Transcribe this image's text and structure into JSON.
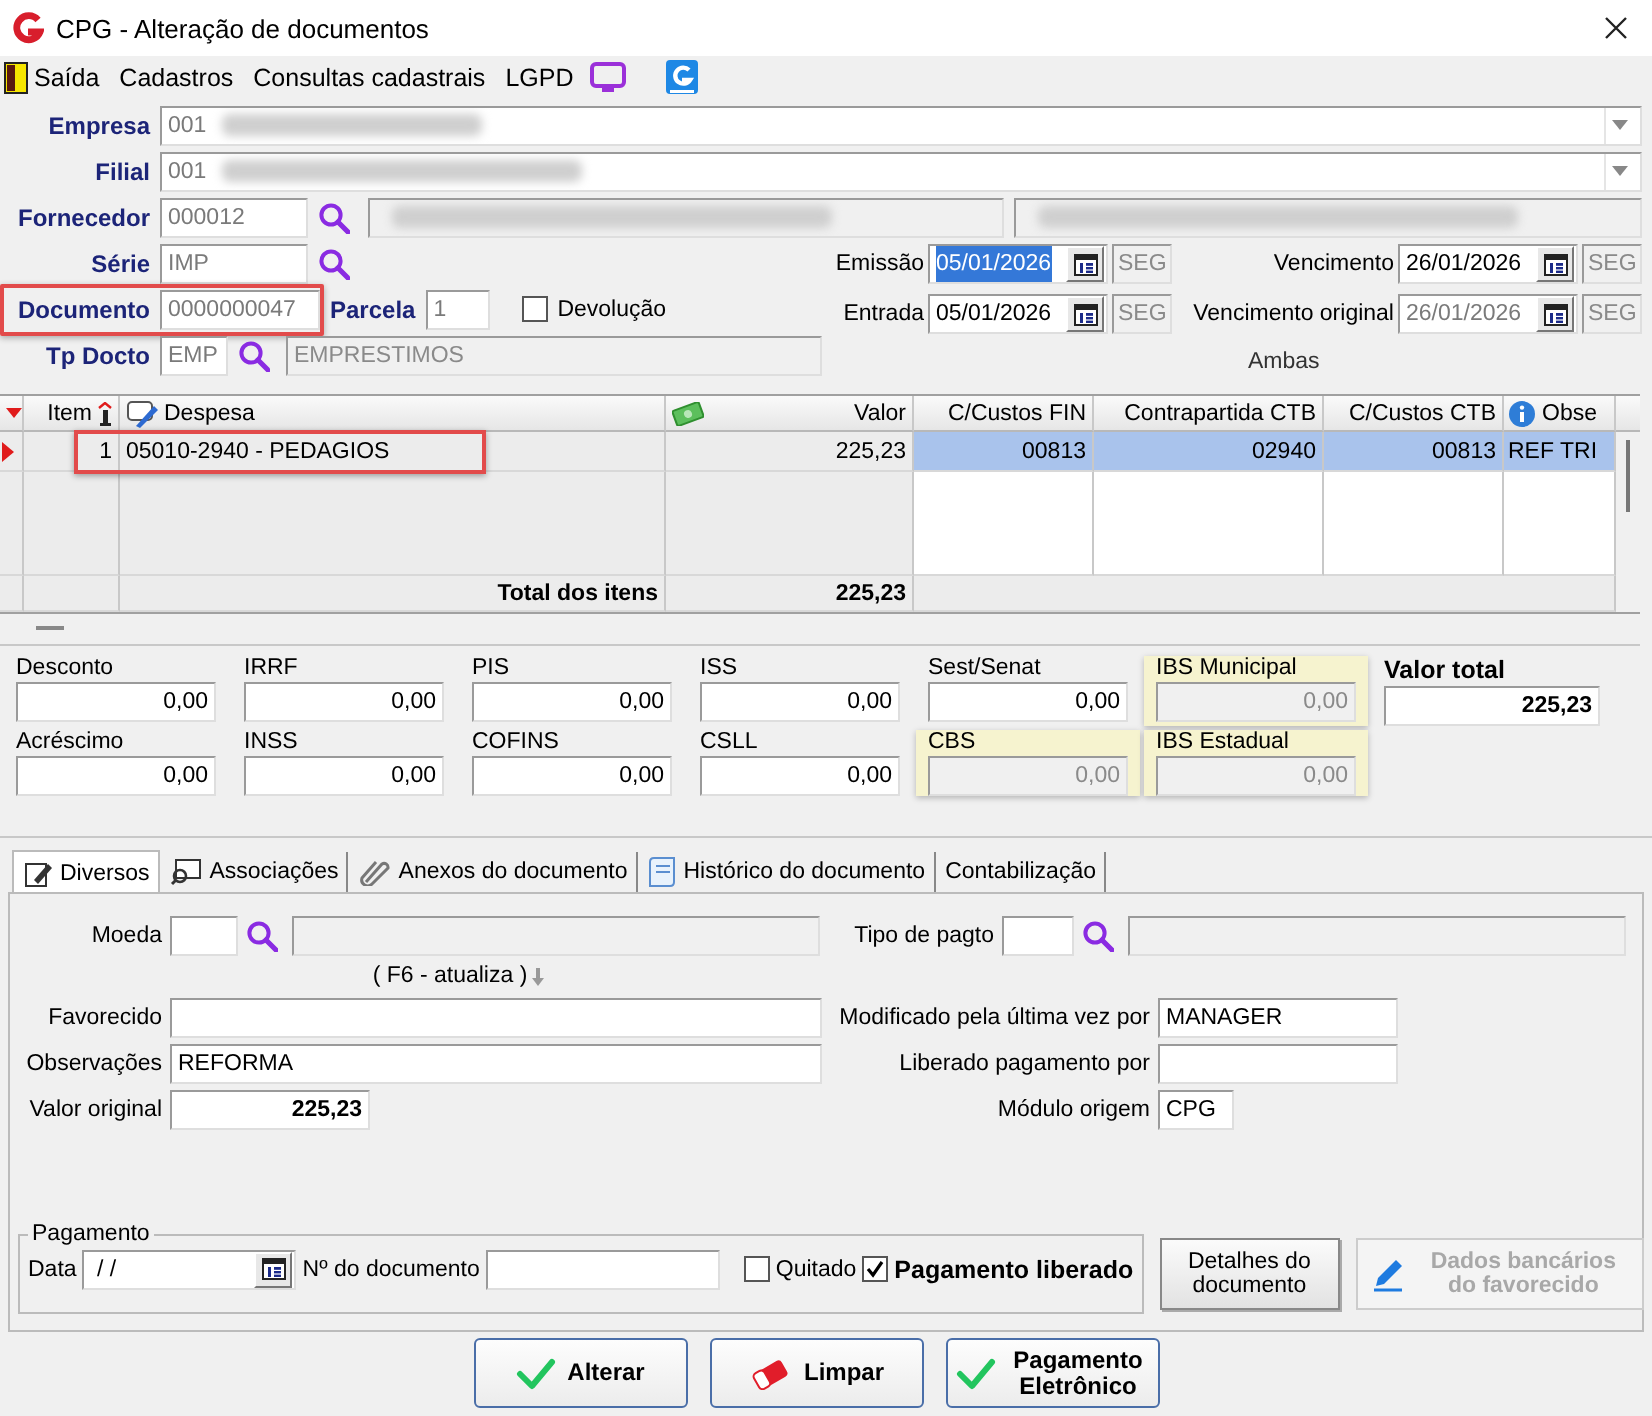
{
  "window": {
    "title": "CPG - Alteração de documentos"
  },
  "menu": [
    {
      "label": "Saída",
      "kind": "exit"
    },
    {
      "label": "Cadastros",
      "kind": "plain"
    },
    {
      "label": "Consultas cadastrais",
      "kind": "plain"
    },
    {
      "label": "LGPD",
      "kind": "plain"
    }
  ],
  "header": {
    "empresa": {
      "label": "Empresa",
      "value": "001"
    },
    "filial": {
      "label": "Filial",
      "value": "001"
    },
    "fornecedor": {
      "label": "Fornecedor",
      "value": "000012"
    },
    "serie": {
      "label": "Série",
      "value": "IMP"
    },
    "documento": {
      "label": "Documento",
      "value": "0000000047",
      "highlighted": true
    },
    "parcela": {
      "label": "Parcela",
      "value": "1"
    },
    "devolucao": {
      "label": "Devolução",
      "checked": false
    },
    "tp_docto": {
      "label": "Tp Docto",
      "value": "EMP",
      "description": "EMPRESTIMOS"
    },
    "dates": [
      {
        "label": "Emissão",
        "value": "05/01/2026",
        "weekday": "SEG",
        "selected": true,
        "disabled": false
      },
      {
        "label": "Vencimento",
        "value": "26/01/2026",
        "weekday": "SEG",
        "selected": false,
        "disabled": false
      },
      {
        "label": "Entrada",
        "value": "05/01/2026",
        "weekday": "SEG",
        "selected": false,
        "disabled": false
      },
      {
        "label": "Vencimento original",
        "value": "26/01/2026",
        "weekday": "SEG",
        "selected": false,
        "disabled": true
      }
    ],
    "note": "Ambas"
  },
  "items": {
    "columns": [
      "Item",
      "Despesa",
      "Valor",
      "C/Custos FIN",
      "Contrapartida CTB",
      "C/Custos CTB",
      "Obse"
    ],
    "rows": [
      {
        "item": "1",
        "despesa": "05010-2940 - PEDAGIOS",
        "valor": "225,23",
        "cc_fin": "00813",
        "contrapartida": "02940",
        "cc_ctb": "00813",
        "column_7": "REF TRI",
        "selected": true,
        "highlighted": true
      }
    ],
    "total_label": "Total dos itens",
    "total": "225,23"
  },
  "totals": [
    {
      "label": "Desconto",
      "value": "0,00",
      "kind": "amount"
    },
    {
      "label": "IRRF",
      "value": "0,00",
      "kind": "amount"
    },
    {
      "label": "PIS",
      "value": "0,00",
      "kind": "amount"
    },
    {
      "label": "ISS",
      "value": "0,00",
      "kind": "amount"
    },
    {
      "label": "Sest/Senat",
      "value": "0,00",
      "kind": "amount"
    },
    {
      "label": "IBS Municipal",
      "value": "0,00",
      "kind": "ibs"
    },
    {
      "label": "Valor total",
      "value": "225,23",
      "kind": "total"
    },
    {
      "label": "Acréscimo",
      "value": "0,00",
      "kind": "amount"
    },
    {
      "label": "INSS",
      "value": "0,00",
      "kind": "amount"
    },
    {
      "label": "COFINS",
      "value": "0,00",
      "kind": "amount"
    },
    {
      "label": "CSLL",
      "value": "0,00",
      "kind": "amount"
    },
    {
      "label": "CBS",
      "value": "0,00",
      "kind": "ibs"
    },
    {
      "label": "IBS Estadual",
      "value": "0,00",
      "kind": "ibs"
    }
  ],
  "tabs": [
    {
      "label": "Diversos",
      "kind": "edit",
      "selected": true
    },
    {
      "label": "Associações",
      "kind": "link",
      "selected": false
    },
    {
      "label": "Anexos do documento",
      "kind": "attach",
      "selected": false
    },
    {
      "label": "Histórico do documento",
      "kind": "history",
      "selected": false
    },
    {
      "label": "Contabilização",
      "kind": "plain",
      "selected": false
    }
  ],
  "diversos": {
    "moeda": {
      "label": "Moeda"
    },
    "tipo_pagto": {
      "label": "Tipo de pagto"
    },
    "refresh_hint": "( F6 - atualiza )",
    "favorecido": {
      "label": "Favorecido"
    },
    "modificado": {
      "label": "Modificado pela última vez por",
      "value": "MANAGER"
    },
    "observacoes": {
      "label": "Observações",
      "value": "REFORMA"
    },
    "liberado_por": {
      "label": "Liberado pagamento por"
    },
    "valor_original": {
      "label": "Valor original",
      "value": "225,23"
    },
    "modulo_origem": {
      "label": "Módulo origem",
      "value": "CPG"
    },
    "pagamento": {
      "title": "Pagamento",
      "data_label": "Data",
      "data_value": " / /",
      "numero_label": "Nº do documento",
      "quitado": {
        "label": "Quitado",
        "checked": false
      },
      "liberado": {
        "label": "Pagamento liberado",
        "checked": true
      }
    },
    "side_buttons": [
      {
        "label": "Detalhes do documento",
        "disabled": false
      },
      {
        "label": "Dados bancários do favorecido",
        "disabled": true
      }
    ]
  },
  "actions": [
    {
      "label": "Alterar",
      "kind": "check"
    },
    {
      "label": "Limpar",
      "kind": "eraser"
    },
    {
      "label": "Pagamento Eletrônico",
      "kind": "check"
    }
  ]
}
